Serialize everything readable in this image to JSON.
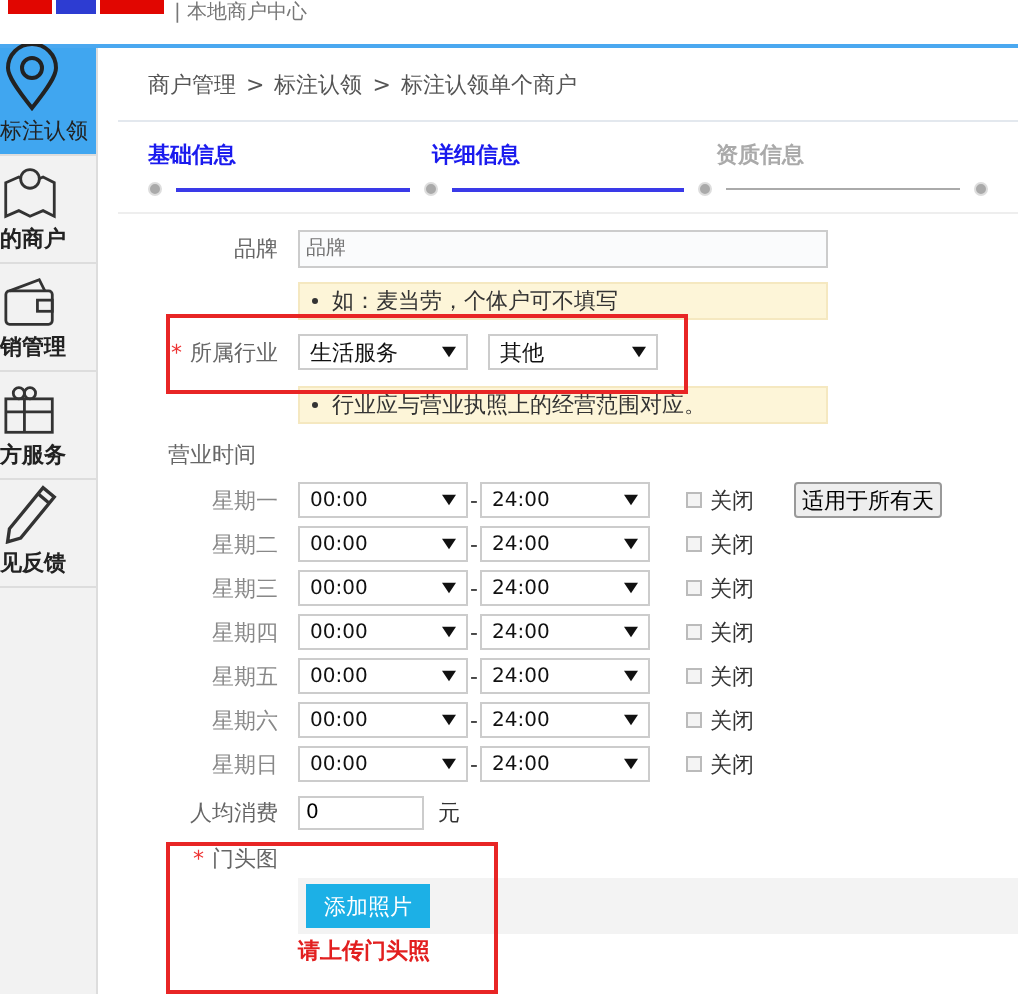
{
  "header": {
    "subtitle": "| 本地商户中心"
  },
  "sidebar": {
    "items": [
      {
        "label": "标注认领",
        "selected": true
      },
      {
        "label": "的商户",
        "selected": false
      },
      {
        "label": "销管理",
        "selected": false
      },
      {
        "label": "方服务",
        "selected": false
      },
      {
        "label": "见反馈",
        "selected": false
      }
    ]
  },
  "breadcrumb": [
    "商户管理",
    "标注认领",
    "标注认领单个商户"
  ],
  "separator": ">",
  "steps": [
    {
      "label": "基础信息",
      "completed": true
    },
    {
      "label": "详细信息",
      "completed": true
    },
    {
      "label": "资质信息",
      "completed": false
    }
  ],
  "brand": {
    "label": "品牌",
    "placeholder": "品牌",
    "tip": "如：麦当劳，个体户可不填写"
  },
  "industry": {
    "label": "所属行业",
    "required_mark": "*",
    "highlighted": true,
    "category": "生活服务",
    "subcategory": "其他",
    "tip": "行业应与营业执照上的经营范围对应。"
  },
  "hours": {
    "label": "营业时间",
    "dash": "-",
    "apply_all": "适用于所有天",
    "days": [
      {
        "day": "星期一",
        "open": "00:00",
        "close": "24:00",
        "closed_label": "关闭",
        "checked": false
      },
      {
        "day": "星期二",
        "open": "00:00",
        "close": "24:00",
        "closed_label": "关闭",
        "checked": false
      },
      {
        "day": "星期三",
        "open": "00:00",
        "close": "24:00",
        "closed_label": "关闭",
        "checked": false
      },
      {
        "day": "星期四",
        "open": "00:00",
        "close": "24:00",
        "closed_label": "关闭",
        "checked": false
      },
      {
        "day": "星期五",
        "open": "00:00",
        "close": "24:00",
        "closed_label": "关闭",
        "checked": false
      },
      {
        "day": "星期六",
        "open": "00:00",
        "close": "24:00",
        "closed_label": "关闭",
        "checked": false
      },
      {
        "day": "星期日",
        "open": "00:00",
        "close": "24:00",
        "closed_label": "关闭",
        "checked": false
      }
    ]
  },
  "avg_spend": {
    "label": "人均消费",
    "value": "0",
    "unit": "元"
  },
  "storefront": {
    "label": "门头图",
    "required_mark": "*",
    "highlighted": true,
    "button": "添加照片",
    "error": "请上传门头照"
  }
}
